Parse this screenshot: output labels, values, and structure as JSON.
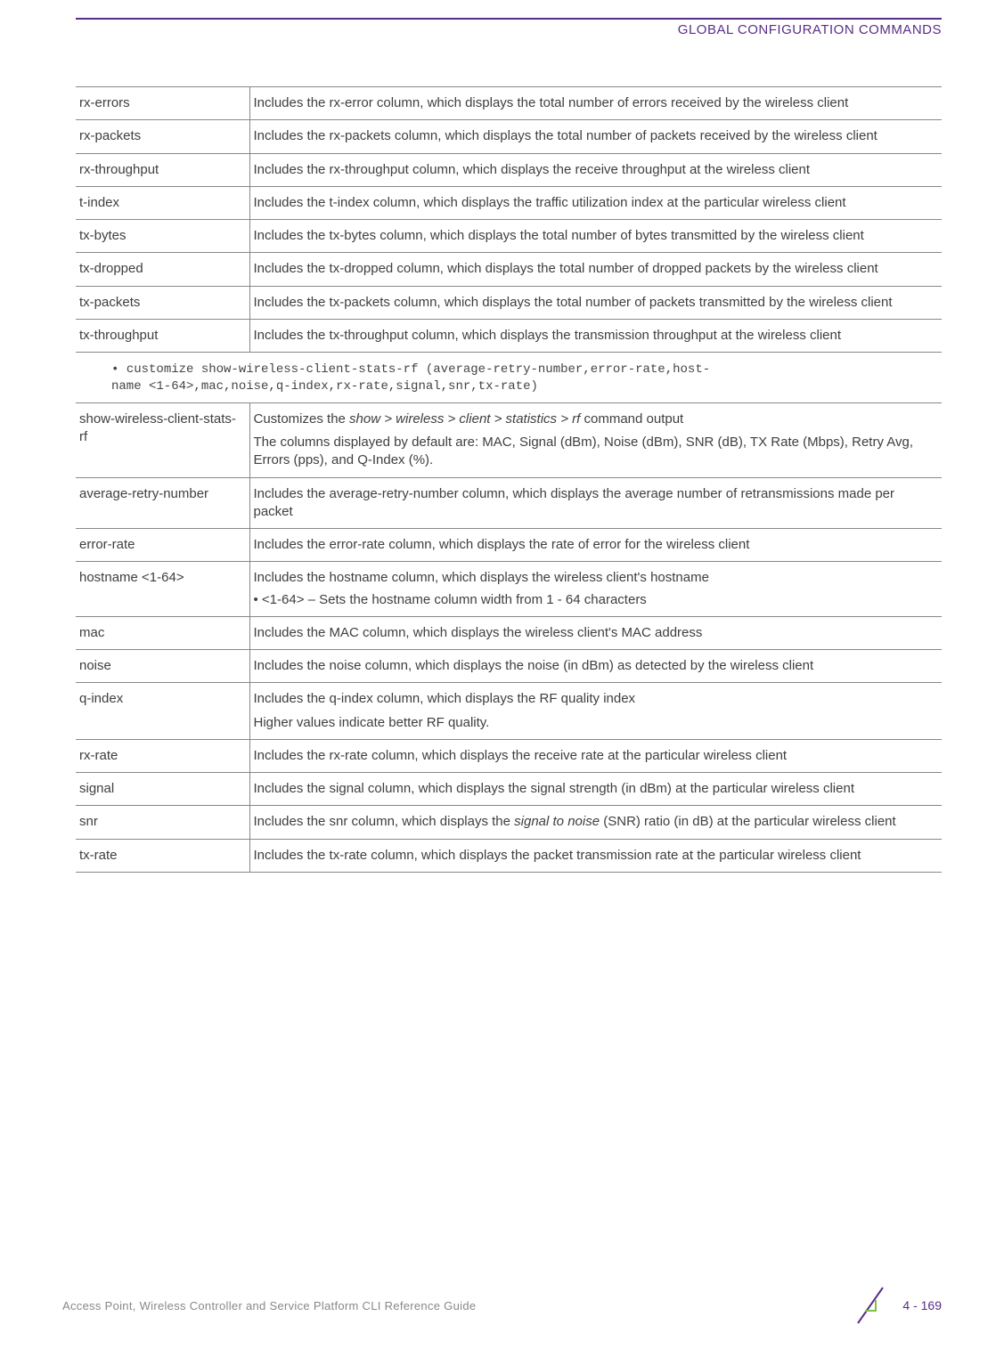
{
  "header": {
    "title": "GLOBAL CONFIGURATION COMMANDS"
  },
  "table1": {
    "rows": [
      {
        "param": "rx-errors",
        "desc": "Includes the rx-error column, which displays the total number of errors received by the wireless client"
      },
      {
        "param": "rx-packets",
        "desc": "Includes the rx-packets column, which displays the total number of packets received by the wireless client"
      },
      {
        "param": "rx-throughput",
        "desc": "Includes the rx-throughput column, which displays the receive throughput at the wireless client"
      },
      {
        "param": "t-index",
        "desc": "Includes the t-index column, which displays the traffic utilization index at the particular wireless client"
      },
      {
        "param": "tx-bytes",
        "desc": "Includes the tx-bytes column, which displays the total number of bytes transmitted by the wireless client"
      },
      {
        "param": "tx-dropped",
        "desc": "Includes the tx-dropped column, which displays the total number of dropped packets by the wireless client"
      },
      {
        "param": "tx-packets",
        "desc": "Includes the tx-packets column, which displays the total number of packets transmitted by the wireless client"
      },
      {
        "param": "tx-throughput",
        "desc": "Includes the tx-throughput column, which displays the transmission throughput at the wireless client"
      }
    ]
  },
  "code": {
    "line1": "customize show-wireless-client-stats-rf (average-retry-number,error-rate,host-",
    "line2": "name <1-64>,mac,noise,q-index,rx-rate,signal,snr,tx-rate)"
  },
  "table2": {
    "rows": {
      "r0": {
        "param": "show-wireless-client-stats-rf",
        "l1a": "Customizes the ",
        "l1b": "show > wireless > client > statistics > rf",
        "l1c": " command output",
        "l2": "The columns displayed by default are: MAC, Signal (dBm), Noise (dBm), SNR (dB), TX Rate (Mbps), Retry Avg, Errors (pps), and Q-Index (%)."
      },
      "r1": {
        "param": "average-retry-number",
        "desc": "Includes the average-retry-number column, which displays the average number of retransmissions made per packet"
      },
      "r2": {
        "param": "error-rate",
        "desc": "Includes the error-rate column, which displays the rate of error for the wireless client"
      },
      "r3": {
        "param": "hostname <1-64>",
        "l1": "Includes the hostname column, which displays the wireless client's hostname",
        "l2": "<1-64> – Sets the hostname column width from 1 - 64 characters"
      },
      "r4": {
        "param": "mac",
        "desc": "Includes the MAC column, which displays the wireless client's MAC address"
      },
      "r5": {
        "param": "noise",
        "desc": "Includes the noise column, which displays the noise (in dBm) as detected by the wireless client"
      },
      "r6": {
        "param": "q-index",
        "l1": "Includes the q-index column, which displays the RF quality index",
        "l2": "Higher values indicate better RF quality."
      },
      "r7": {
        "param": "rx-rate",
        "desc": "Includes the rx-rate column, which displays the receive rate at the particular wireless client"
      },
      "r8": {
        "param": "signal",
        "desc": "Includes the signal column, which displays the signal strength (in dBm) at the particular wireless client"
      },
      "r9": {
        "param": "snr",
        "l1a": "Includes the snr column, which displays the ",
        "l1b": "signal to noise",
        "l1c": " (SNR) ratio (in dB) at the particular wireless client"
      },
      "r10": {
        "param": "tx-rate",
        "desc": "Includes the tx-rate column, which displays the packet transmission rate at the particular wireless client"
      }
    }
  },
  "footer": {
    "text": "Access Point, Wireless Controller and Service Platform CLI Reference Guide",
    "page": "4 - 169"
  }
}
